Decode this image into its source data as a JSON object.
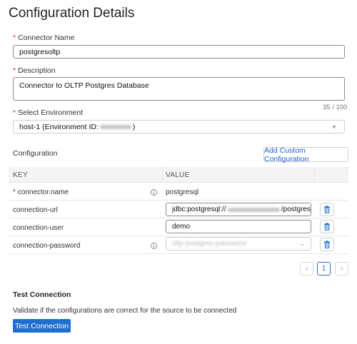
{
  "page": {
    "title": "Configuration Details"
  },
  "connector_name": {
    "label": "Connector Name",
    "value": "postgresoltp"
  },
  "description": {
    "label": "Description",
    "value": "Connector to OLTP Postgres Database",
    "counter": "35 / 100"
  },
  "environment": {
    "label": "Select Environment",
    "value_prefix": "host-1 (Environment ID: ",
    "value_suffix": ")"
  },
  "configuration": {
    "heading": "Configuration",
    "add_button": "Add Custom Configuration",
    "columns": {
      "key": "KEY",
      "value": "VALUE"
    },
    "rows": [
      {
        "required": "*",
        "key": "connector.name",
        "value": "postgresql"
      },
      {
        "key": "connection-url",
        "value_prefix": "jdbc:postgresql://",
        "value_suffix": "/postgres"
      },
      {
        "key": "connection-user",
        "value": "demo"
      },
      {
        "key": "connection-password",
        "value": "oltp-postgres-password"
      }
    ]
  },
  "pagination": {
    "prev": "‹",
    "page": "1",
    "next": "›"
  },
  "test_connection": {
    "heading": "Test Connection",
    "description": "Validate if the configurations are correct for the source to be connected",
    "button": "Test Connection"
  },
  "colors": {
    "accent": "#1f6fd1",
    "required": "#d9302a"
  }
}
